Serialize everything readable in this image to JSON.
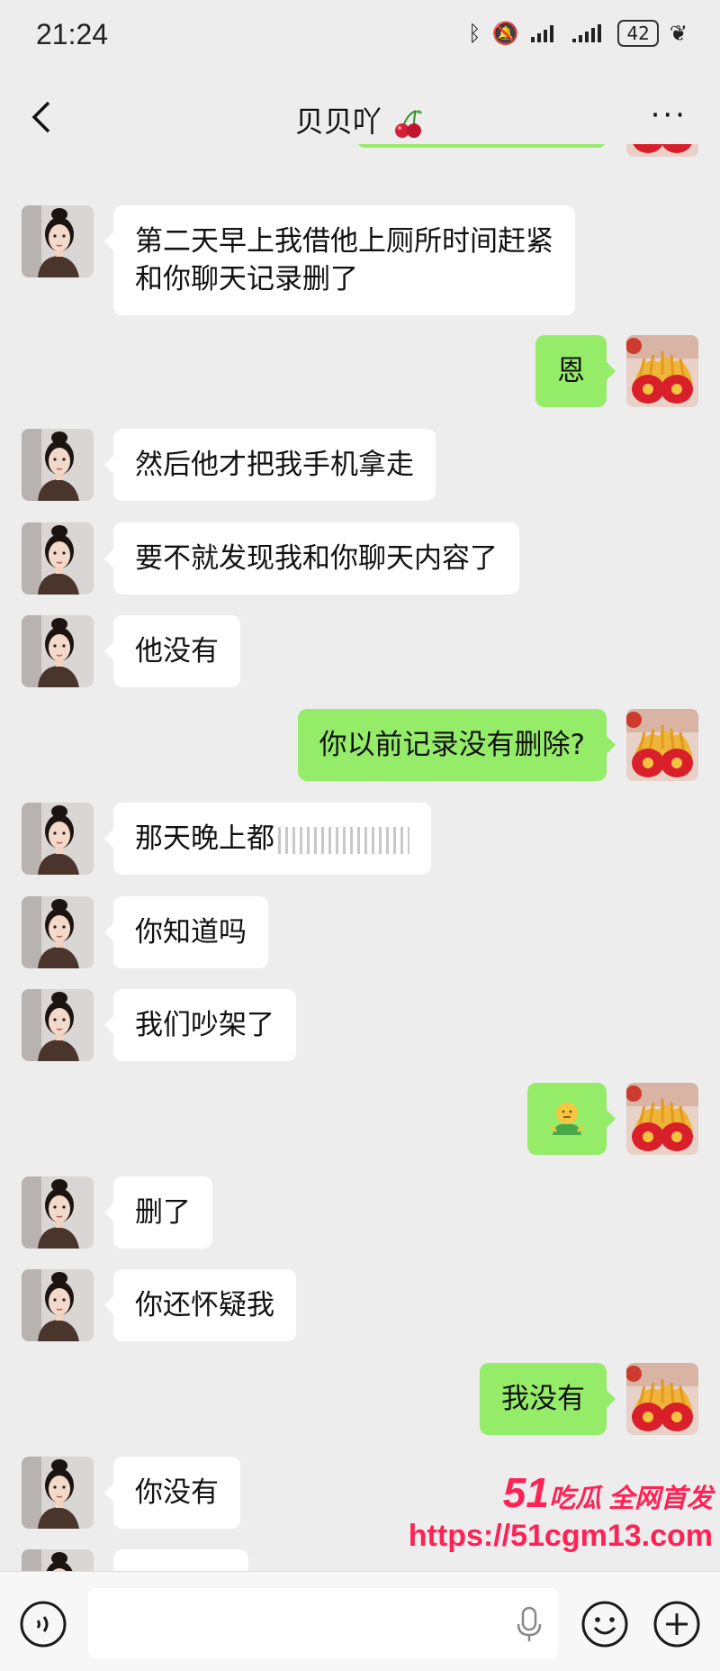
{
  "status_bar": {
    "time": "21:24",
    "battery": "42"
  },
  "header": {
    "title": "贝贝吖"
  },
  "messages": [
    {
      "side": "out",
      "text": ""
    },
    {
      "side": "in",
      "text": "第二天早上我借他上厕所时间赶紧\n和你聊天记录删了"
    },
    {
      "side": "out",
      "text": "恩"
    },
    {
      "side": "in",
      "text": "然后他才把我手机拿走"
    },
    {
      "side": "in",
      "text": "要不就发现我和你聊天内容了"
    },
    {
      "side": "in",
      "text": "他没有"
    },
    {
      "side": "out",
      "text": "你以前记录没有删除?"
    },
    {
      "side": "in",
      "text": "那天晚上都"
    },
    {
      "side": "in",
      "text": "你知道吗"
    },
    {
      "side": "in",
      "text": "我们吵架了"
    },
    {
      "side": "out",
      "text": "",
      "icon": "shrug-emoji-icon"
    },
    {
      "side": "in",
      "text": "删了"
    },
    {
      "side": "in",
      "text": "你还怀疑我"
    },
    {
      "side": "out",
      "text": "我没有"
    },
    {
      "side": "in",
      "text": "你没有"
    },
    {
      "side": "in",
      "text": ""
    }
  ],
  "input_bar": {
    "placeholder": ""
  },
  "watermark": {
    "brand_num": "51",
    "brand_text": "吃瓜 全网首发",
    "url": "https://51cgm13.com"
  },
  "colors": {
    "incoming_bubble": "#ffffff",
    "outgoing_bubble": "#95ec69",
    "background": "#ededed",
    "watermark": "#ff2255"
  }
}
